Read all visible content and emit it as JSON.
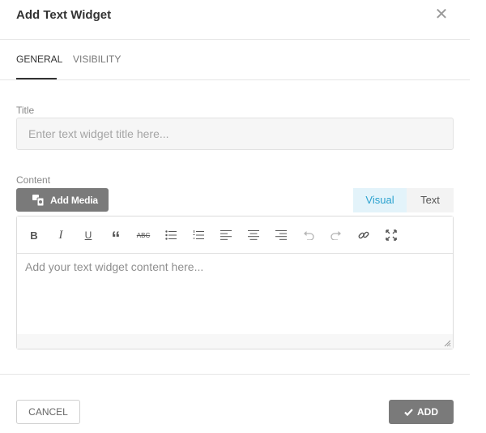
{
  "dialog": {
    "title": "Add Text Widget",
    "close_glyph": "✕"
  },
  "tabs": [
    {
      "label": "GENERAL",
      "active": true
    },
    {
      "label": "VISIBILITY",
      "active": false
    }
  ],
  "form": {
    "title_label": "Title",
    "title_placeholder": "Enter text widget title here...",
    "title_value": "",
    "content_label": "Content",
    "add_media_label": "Add Media",
    "mode_tabs": [
      {
        "label": "Visual",
        "active": true
      },
      {
        "label": "Text",
        "active": false
      }
    ],
    "editor_placeholder": "Add your text widget content here...",
    "toolbar": [
      {
        "icon": "bold-icon",
        "glyph": "B"
      },
      {
        "icon": "italic-icon",
        "glyph": "I"
      },
      {
        "icon": "underline-icon",
        "glyph": "U"
      },
      {
        "icon": "blockquote-icon",
        "glyph": "“"
      },
      {
        "icon": "strikethrough-icon",
        "glyph": "ABC"
      },
      {
        "icon": "bullet-list-icon"
      },
      {
        "icon": "numbered-list-icon"
      },
      {
        "icon": "align-left-icon"
      },
      {
        "icon": "align-center-icon"
      },
      {
        "icon": "align-right-icon"
      },
      {
        "icon": "undo-icon"
      },
      {
        "icon": "redo-icon"
      },
      {
        "icon": "link-icon"
      },
      {
        "icon": "fullscreen-icon"
      }
    ]
  },
  "footer": {
    "cancel_label": "CANCEL",
    "add_label": "ADD"
  },
  "colors": {
    "active_mode_bg": "#e3f3fa",
    "active_mode_text": "#2ba2cf",
    "button_gray": "#7a7a7a"
  }
}
